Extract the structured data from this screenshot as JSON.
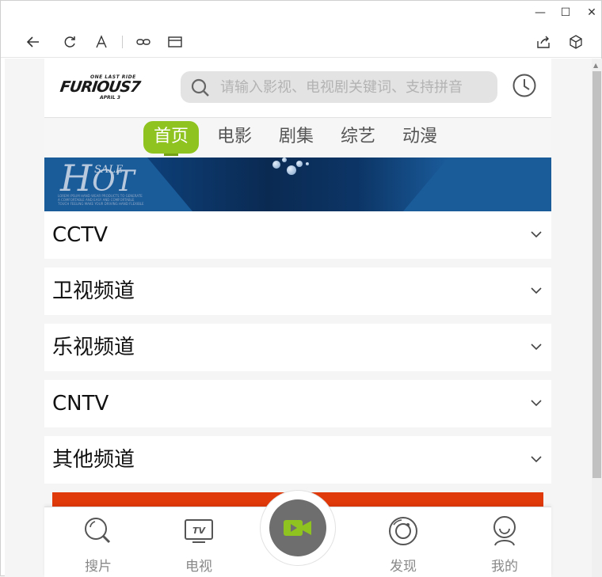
{
  "window": {
    "minimize_glyph": "—",
    "maximize_glyph": "☐",
    "close_glyph": "✕"
  },
  "toolbar": {
    "icons": [
      "back-icon",
      "refresh-icon",
      "font-icon",
      "link-icon",
      "window-icon",
      "share-icon",
      "package-icon"
    ]
  },
  "header": {
    "logo": {
      "top": "ONE LAST RIDE",
      "main": "FURIOUS7",
      "sub": "APRIL 3"
    },
    "search": {
      "placeholder": "请输入影视、电视剧关键词、支持拼音"
    }
  },
  "nav": {
    "tabs": [
      {
        "label": "首页",
        "active": true
      },
      {
        "label": "电影",
        "active": false
      },
      {
        "label": "剧集",
        "active": false
      },
      {
        "label": "综艺",
        "active": false
      },
      {
        "label": "动漫",
        "active": false
      }
    ]
  },
  "banner": {
    "hot_h": "H",
    "hot_ot": "OT",
    "sale": "SALE",
    "fine_print": "LOREM IPSUM HAND WEAR PRODUCTS TO GENERATE A COMFORTABLE AND EASY AND COMFORTABLE TOUCH FEELING MAKE YOUR DRIVING HAND FLEXIBLE"
  },
  "categories": [
    {
      "label": "CCTV"
    },
    {
      "label": "卫视频道"
    },
    {
      "label": "乐视频道"
    },
    {
      "label": "CNTV"
    },
    {
      "label": "其他频道"
    }
  ],
  "bottom_nav": {
    "items": [
      {
        "label": "搜片",
        "icon": "search-film-icon"
      },
      {
        "label": "电视",
        "icon": "tv-icon"
      },
      {
        "label": "",
        "icon": "video-camera-icon"
      },
      {
        "label": "发现",
        "icon": "discover-icon"
      },
      {
        "label": "我的",
        "icon": "profile-icon"
      }
    ]
  },
  "colors": {
    "accent": "#8fc31f",
    "banner": "#1a5b9a",
    "red_bar": "#e0390a"
  }
}
